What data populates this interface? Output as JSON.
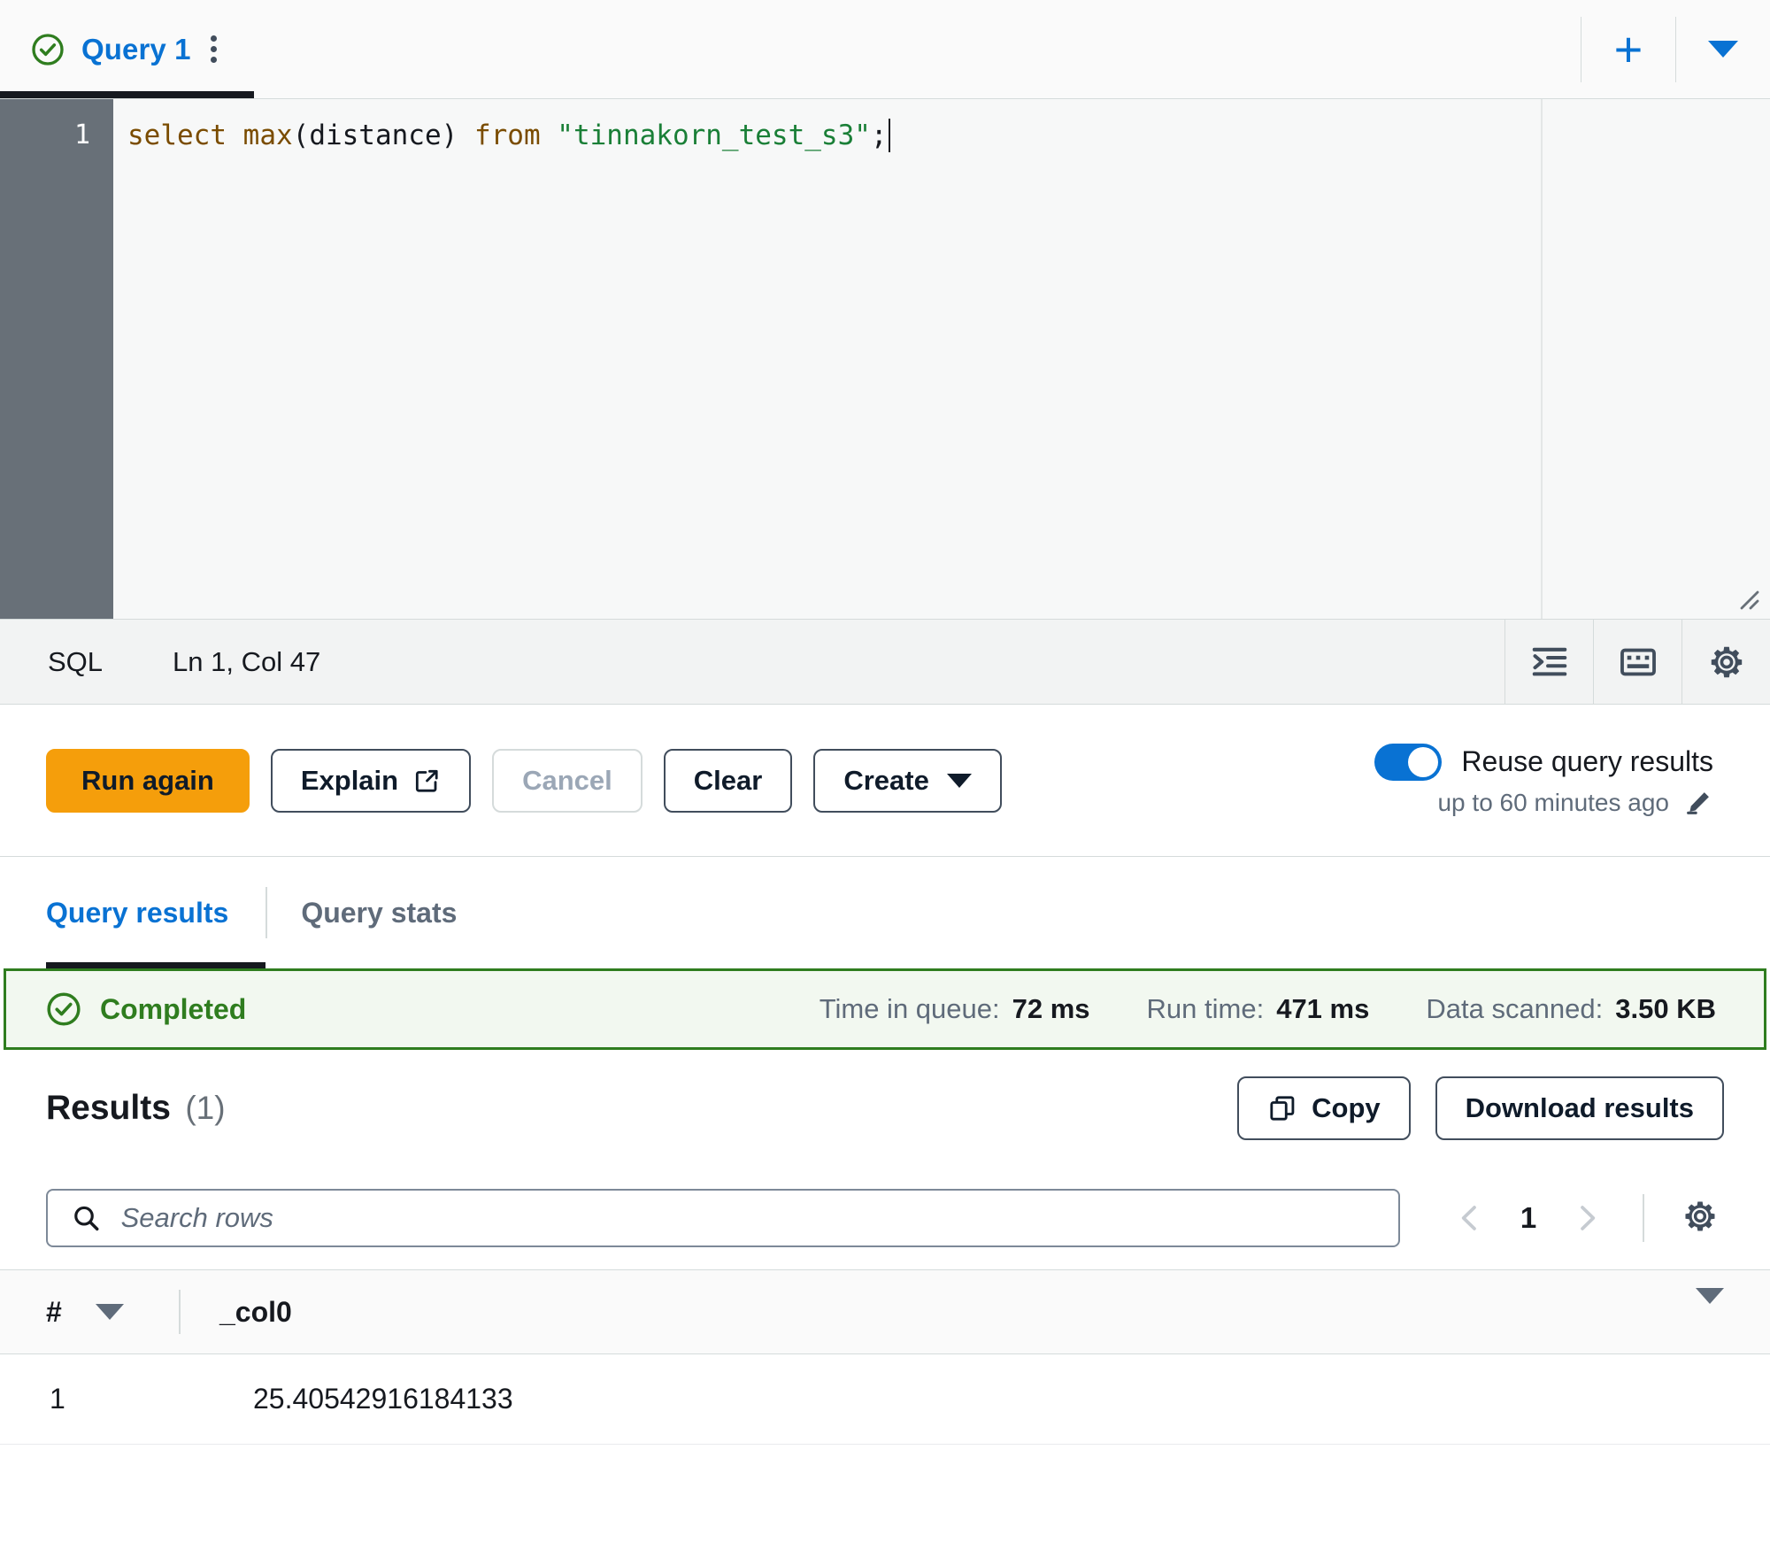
{
  "tab_bar": {
    "status_icon": "check-circle-icon",
    "query_tab_label": "Query 1",
    "menu_icon": "kebab-menu-icon",
    "add_icon": "plus-icon",
    "more_icon": "chevron-down-icon"
  },
  "editor": {
    "line_number": "1",
    "code_tokens": [
      {
        "text": "select ",
        "type": "keyword"
      },
      {
        "text": "max",
        "type": "function"
      },
      {
        "text": "(distance) ",
        "type": "plain"
      },
      {
        "text": "from ",
        "type": "keyword"
      },
      {
        "text": "\"tinnakorn_test_s3\"",
        "type": "string"
      },
      {
        "text": ";",
        "type": "plain"
      }
    ],
    "code_text": "select max(distance) from \"tinnakorn_test_s3\";",
    "resize_icon": "resize-grip-icon"
  },
  "status_bar": {
    "language": "SQL",
    "cursor_position": "Ln 1, Col 47",
    "tools": [
      {
        "name": "format-query-icon",
        "label": "Format query"
      },
      {
        "name": "keyboard-shortcuts-icon",
        "label": "Keyboard shortcuts"
      },
      {
        "name": "editor-settings-gear-icon",
        "label": "Editor settings"
      }
    ]
  },
  "actions": {
    "run_again": "Run again",
    "explain": "Explain",
    "explain_icon": "external-link-icon",
    "cancel": "Cancel",
    "clear": "Clear",
    "create": "Create",
    "create_caret": "chevron-down-icon",
    "reuse_label": "Reuse query results",
    "reuse_enabled": true,
    "reuse_sub": "up to 60 minutes ago",
    "reuse_edit_icon": "pencil-edit-icon"
  },
  "result_tabs": [
    {
      "label": "Query results",
      "active": true
    },
    {
      "label": "Query stats",
      "active": false
    }
  ],
  "banner": {
    "status_icon": "check-circle-icon",
    "status": "Completed",
    "metrics": [
      {
        "label": "Time in queue:",
        "value": "72 ms"
      },
      {
        "label": "Run time:",
        "value": "471 ms"
      },
      {
        "label": "Data scanned:",
        "value": "3.50 KB"
      }
    ]
  },
  "results": {
    "title": "Results",
    "count": "(1)",
    "copy_label": "Copy",
    "copy_icon": "copy-icon",
    "download_label": "Download results",
    "search_placeholder": "Search rows",
    "search_value": "",
    "search_icon": "search-icon",
    "prev_icon": "chevron-left-icon",
    "next_icon": "chevron-right-icon",
    "page_number": "1",
    "settings_icon": "table-settings-gear-icon",
    "columns": [
      {
        "label": "#",
        "sortable": true
      },
      {
        "label": "_col0",
        "sortable": false
      }
    ],
    "rows": [
      {
        "index": "1",
        "_col0": "25.40542916184133"
      }
    ]
  },
  "colors": {
    "accent_blue": "#0972d3",
    "primary_orange": "#f59e0b",
    "success_green": "#2f7d1f",
    "banner_bg": "#f2f8f0",
    "gutter_bg": "#687078"
  }
}
